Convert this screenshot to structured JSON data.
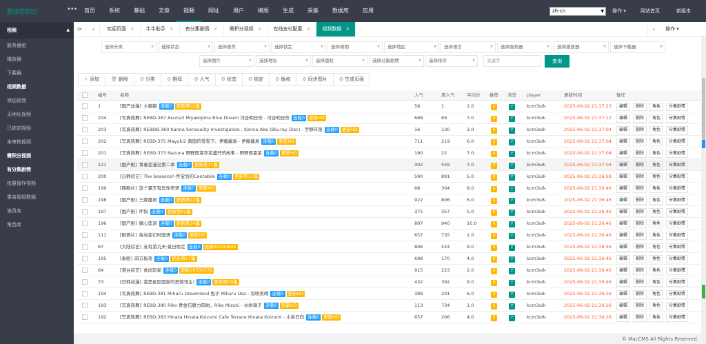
{
  "app": {
    "logo": "超级控制台",
    "menu_icon": "menu-dots-icon"
  },
  "topnav": [
    "首页",
    "系统",
    "基础",
    "文章",
    "视频",
    "网址",
    "用户",
    "模版",
    "生成",
    "采集",
    "数据库",
    "应用"
  ],
  "topnav_active": 4,
  "lang": "zh-cn",
  "topright": {
    "ops": "操作",
    "home": "网站首页",
    "new": "新版本"
  },
  "sidebar": {
    "group": "视频",
    "items": [
      {
        "label": "服务器组",
        "bold": false
      },
      {
        "label": "播放器",
        "bold": false
      },
      {
        "label": "下载器",
        "bold": false
      },
      {
        "label": "视频数据",
        "bold": true
      },
      {
        "label": "添加视频",
        "bold": false
      },
      {
        "label": "无地址视频",
        "bold": false
      },
      {
        "label": "已锁定视频",
        "bold": false
      },
      {
        "label": "未审核视频",
        "bold": false
      },
      {
        "label": "需积分视频",
        "bold": true
      },
      {
        "label": "有分集剧情",
        "bold": true
      },
      {
        "label": "批量操作视频",
        "bold": false
      },
      {
        "label": "重名视频数据",
        "bold": false
      },
      {
        "label": "演员库",
        "bold": false
      },
      {
        "label": "角色库",
        "bold": false
      }
    ]
  },
  "tabs": [
    "欢迎页面",
    "牛牛助手",
    "有分集剧情",
    "需积分视频",
    "在线支付配置",
    "视频数据"
  ],
  "tab_active": 5,
  "tab_ops": "操作",
  "filters": [
    "选择分类",
    "选择状态",
    "选择推荐",
    "选择锁定",
    "选择周期",
    "选择地区",
    "选择语言",
    "选择服务器",
    "选择播放器",
    "选择下载器",
    "选择图片",
    "选择地址",
    "选择版权",
    "选择分集剧情",
    "选择排序"
  ],
  "keyword_placeholder": "关键字",
  "query_btn": "查询",
  "actions": [
    {
      "icon": "+",
      "label": "添加"
    },
    {
      "icon": "🗑",
      "label": "删除"
    },
    {
      "icon": "⚙",
      "label": "分类"
    },
    {
      "icon": "⚙",
      "label": "推荐"
    },
    {
      "icon": "⚙",
      "label": "人气"
    },
    {
      "icon": "⚙",
      "label": "状态"
    },
    {
      "icon": "⚙",
      "label": "锁定"
    },
    {
      "icon": "⚙",
      "label": "版权"
    },
    {
      "icon": "⚙",
      "label": "同步图片"
    },
    {
      "icon": "⚙",
      "label": "生成页面"
    }
  ],
  "columns": {
    "id": "编号",
    "name": "名称",
    "hits": "人气",
    "week": "周人气",
    "score": "平均分",
    "recom": "推荐",
    "browse": "浏览",
    "player": "player",
    "time": "更新时间",
    "ops": "操作"
  },
  "row_tag": "连载0",
  "badges": {
    "recom": "0",
    "browse": "Y"
  },
  "op_labels": [
    "编辑",
    "删除",
    "角色",
    "分集剧情"
  ],
  "rows": [
    {
      "id": "1",
      "cat": "[国产动漫]",
      "title": "大猪猪",
      "upd": "更新第02集",
      "hits": "58",
      "week": "1",
      "score": "1.0",
      "player": "kcm3u8-",
      "time": "2025-06-02 21:37:23"
    },
    {
      "id": "204",
      "cat": "[写真热舞]",
      "title": "REBD-367 Asuna3 Miyakojima Blue Dream 河合明日奈 - 河合明日奈",
      "upd": "更新HD",
      "hits": "688",
      "week": "69",
      "score": "7.0",
      "player": "kcm3u8-",
      "time": "2025-06-02 21:37:12"
    },
    {
      "id": "203",
      "cat": "[写真热舞]",
      "title": "REBDB-360 Kanna Sensuality Investigation , Kanna Abe (Blu-ray Disc) - 宇野环菜",
      "upd": "更新HD",
      "hits": "16",
      "week": "130",
      "score": "2.0",
      "player": "kcm3u8-",
      "time": "2025-06-02 21:37:04"
    },
    {
      "id": "202",
      "cat": "[写真热舞]",
      "title": "REBD-375 Mayuki2 南国的雪雪下。伊藤麗真 - 伊藤麗真",
      "upd": "更新HD",
      "hits": "711",
      "week": "219",
      "score": "6.0",
      "player": "kcm3u8-",
      "time": "2025-06-02 21:37:04"
    },
    {
      "id": "201",
      "cat": "[写真热舞]",
      "title": "REBD-373 Nazuna 野野原芽衣花盛开的故事 - 野野原夏菜",
      "upd": "更新HD",
      "hits": "190",
      "week": "22",
      "score": "7.0",
      "player": "kcm3u8-",
      "time": "2025-06-02 21:37:04"
    },
    {
      "id": "121",
      "cat": "[国产剧]",
      "title": "青春变漫记第二季",
      "upd": "更新第11集",
      "hits": "302",
      "week": "559",
      "score": "7.0",
      "player": "kcm3u8-",
      "time": "2025-06-02 21:37:04",
      "hl": true
    },
    {
      "id": "200",
      "cat": "[日韩综艺]",
      "title": "The Seasons?-乔宝剑的Cantabile",
      "upd": "更新第11集",
      "hits": "590",
      "week": "891",
      "score": "5.0",
      "player": "kcm3u8-",
      "time": "2025-06-02 21:36:58"
    },
    {
      "id": "199",
      "cat": "[韩剧片]",
      "title": "这个夏天有异性寄语",
      "upd": "更新HD",
      "hits": "68",
      "week": "304",
      "score": "8.0",
      "player": "kcm3u8-",
      "time": "2025-06-02 21:36:46"
    },
    {
      "id": "198",
      "cat": "[国产剧]",
      "title": "三嫁魔君",
      "upd": "更新第22集",
      "hits": "922",
      "week": "806",
      "score": "6.0",
      "player": "kcm3u8-",
      "time": "2025-06-02 21:36:46"
    },
    {
      "id": "197",
      "cat": "[国产剧]",
      "title": "坏狗",
      "upd": "更新第02集",
      "hits": "375",
      "week": "357",
      "score": "5.0",
      "player": "kcm3u8-",
      "time": "2025-06-02 21:36:46"
    },
    {
      "id": "196",
      "cat": "[国产剧]",
      "title": "娜心莲滚",
      "upd": "更新第24集",
      "hits": "897",
      "week": "940",
      "score": "10.0",
      "player": "kcm3u8-",
      "time": "2025-06-02 21:36:46"
    },
    {
      "id": "111",
      "cat": "[剧情片]",
      "title": "每当变幻时国语",
      "upd": "更新HD",
      "hits": "657",
      "week": "735",
      "score": "1.0",
      "player": "kcm3u8-",
      "time": "2025-06-02 21:36:46"
    },
    {
      "id": "67",
      "cat": "[大陆综艺]",
      "title": "友有游几天·夏日限定",
      "upd": "更新20250601",
      "hits": "806",
      "week": "524",
      "score": "9.0",
      "player": "kcm3u8-",
      "time": "2025-06-02 21:36:46"
    },
    {
      "id": "195",
      "cat": "[泰剧]",
      "title": "四方极夜",
      "upd": "更新第17集",
      "hits": "698",
      "week": "170",
      "score": "4.0",
      "player": "kcm3u8-",
      "time": "2025-06-02 21:36:46"
    },
    {
      "id": "64",
      "cat": "[港台综艺]",
      "title": "食尚玩家",
      "upd": "更新20250530",
      "hits": "915",
      "week": "223",
      "score": "2.0",
      "player": "kcm3u8-",
      "time": "2025-06-02 21:36:46"
    },
    {
      "id": "73",
      "cat": "[日韩动漫]",
      "title": "我是星际国家的恶德领主!",
      "upd": "更新第09集",
      "hits": "432",
      "week": "392",
      "score": "9.0",
      "player": "kcm3u8-",
      "time": "2025-06-02 21:36:46"
    },
    {
      "id": "194",
      "cat": "[写真热舞]",
      "title": "REBD-381 Miharu Dreamland 兔子 Miharu Usa - 羽咲美晴",
      "upd": "更新HD",
      "hits": "388",
      "week": "201",
      "score": "6.0",
      "player": "kcm3u8-",
      "time": "2025-06-02 21:36:26"
    },
    {
      "id": "193",
      "cat": "[写真热舞]",
      "title": "REBD-380 Riko 青金石魅力四射。Riko Mizuki - 水树璃子",
      "upd": "更新HD",
      "hits": "113",
      "week": "734",
      "score": "1.0",
      "player": "kcm3u8-",
      "time": "2025-06-02 21:36:26"
    },
    {
      "id": "192",
      "cat": "[写真热舞]",
      "title": "REBD-383 Hinata Hinata Koizumi Cafe Terrace Hinata Koizumi - 小泉日向",
      "upd": "更新HD",
      "hits": "657",
      "week": "206",
      "score": "4.0",
      "player": "kcm3u8-",
      "time": "2025-06-02 21:36:26"
    }
  ],
  "footer": "© MacCMS All Rights Reserved."
}
